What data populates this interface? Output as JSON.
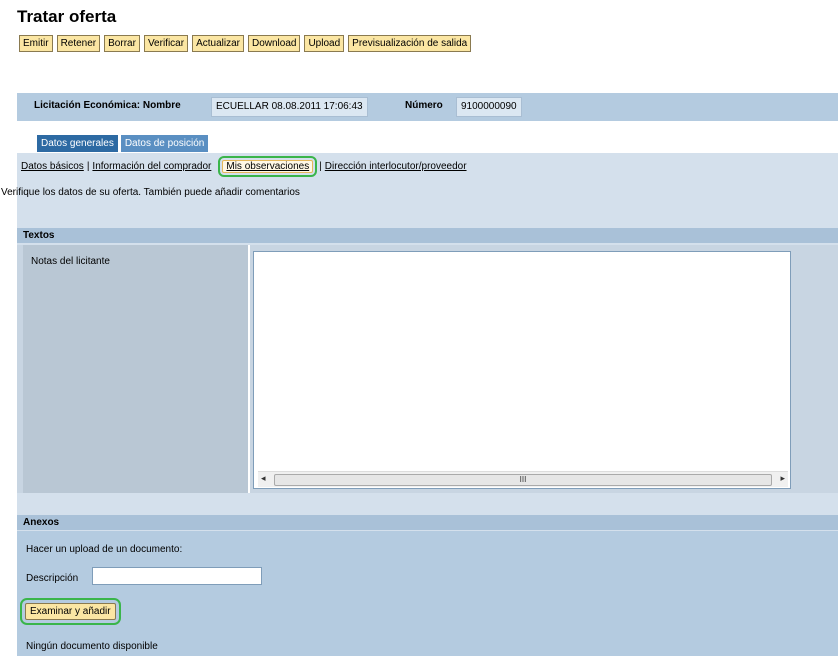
{
  "page": {
    "title": "Tratar oferta"
  },
  "toolbar": {
    "buttons": [
      "Emitir",
      "Retener",
      "Borrar",
      "Verificar",
      "Actualizar",
      "Download",
      "Upload",
      "Previsualización de salida"
    ]
  },
  "header": {
    "name_label": "Licitación Económica: Nombre",
    "name_value": "ECUELLAR 08.08.2011 17:06:43",
    "number_label": "Número",
    "number_value": "9100000090"
  },
  "tabs": [
    "Datos generales",
    "Datos de posición"
  ],
  "subnav": {
    "items": [
      "Datos básicos",
      "Información del comprador",
      "Mis observaciones",
      "Dirección interlocutor/proveedor"
    ],
    "separator": "|"
  },
  "intro": "Verifique los datos de su oferta. También puede añadir comentarios",
  "textos": {
    "title": "Textos",
    "notes_label": "Notas del licitante",
    "notes_value": "",
    "scroll_left": "◂",
    "scroll_right": "▸",
    "scroll_grip": "III"
  },
  "anexos": {
    "title": "Anexos",
    "upload_text": "Hacer un upload de un documento:",
    "desc_label": "Descripción",
    "desc_value": "",
    "add_button": "Examinar y añadir",
    "no_docs": "Ningún documento disponible"
  },
  "colors": {
    "accent": "#2d6aa3",
    "button": "#fbe6a3",
    "highlight": "#3ab54a"
  }
}
